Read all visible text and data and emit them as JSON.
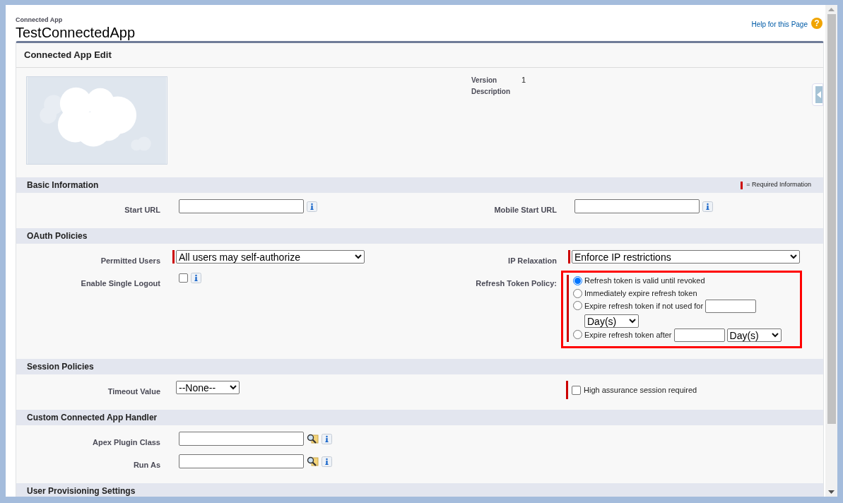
{
  "header": {
    "breadcrumb": "Connected App",
    "title": "TestConnectedApp",
    "help_link": "Help for this Page",
    "help_icon": "?"
  },
  "panel": {
    "title": "Connected App Edit"
  },
  "details": [
    {
      "label": "Version",
      "value": "1"
    },
    {
      "label": "Description"
    }
  ],
  "required_legend": "= Required Information",
  "sections": [
    {
      "title": "Basic Information",
      "rows": [
        [
          {
            "kind": "text",
            "label": "Start URL",
            "required": false,
            "info": true
          },
          {
            "kind": "text",
            "label": "Mobile Start URL",
            "required": false,
            "info": true
          }
        ]
      ]
    },
    {
      "title": "OAuth Policies",
      "rows": [
        [
          {
            "kind": "select",
            "label": "Permitted Users",
            "required": true,
            "value": "All users may self-authorize"
          },
          {
            "kind": "select",
            "label": "IP Relaxation",
            "required": true,
            "value": "Enforce IP restrictions"
          }
        ],
        [
          {
            "kind": "checkbox",
            "label": "Enable Single Logout",
            "checked": false,
            "info": true
          },
          {
            "kind": "radio_group",
            "label": "Refresh Token Policy:",
            "required": true,
            "highlighted": true,
            "options": [
              {
                "kind": "plain",
                "label": "Refresh token is valid until revoked",
                "selected": true
              },
              {
                "kind": "plain",
                "label": "Immediately expire refresh token",
                "selected": false
              },
              {
                "kind": "amount",
                "label": "Expire refresh token if not used for",
                "unit": "Day(s)",
                "selected": false
              },
              {
                "kind": "amount",
                "label": "Expire refresh token after",
                "unit": "Day(s)",
                "selected": false
              }
            ]
          }
        ]
      ]
    },
    {
      "title": "Session Policies",
      "rows": [
        [
          {
            "kind": "select",
            "label": "Timeout Value",
            "required": false,
            "value": "--None--"
          },
          {
            "kind": "checkbox_text",
            "text": "High assurance session required",
            "required": true,
            "checked": false
          }
        ]
      ]
    },
    {
      "title": "Custom Connected App Handler",
      "rows": [
        [
          {
            "kind": "lookup",
            "label": "Apex Plugin Class",
            "info": true
          }
        ],
        [
          {
            "kind": "lookup",
            "label": "Run As",
            "info": true
          }
        ]
      ]
    },
    {
      "title": "User Provisioning Settings"
    }
  ]
}
